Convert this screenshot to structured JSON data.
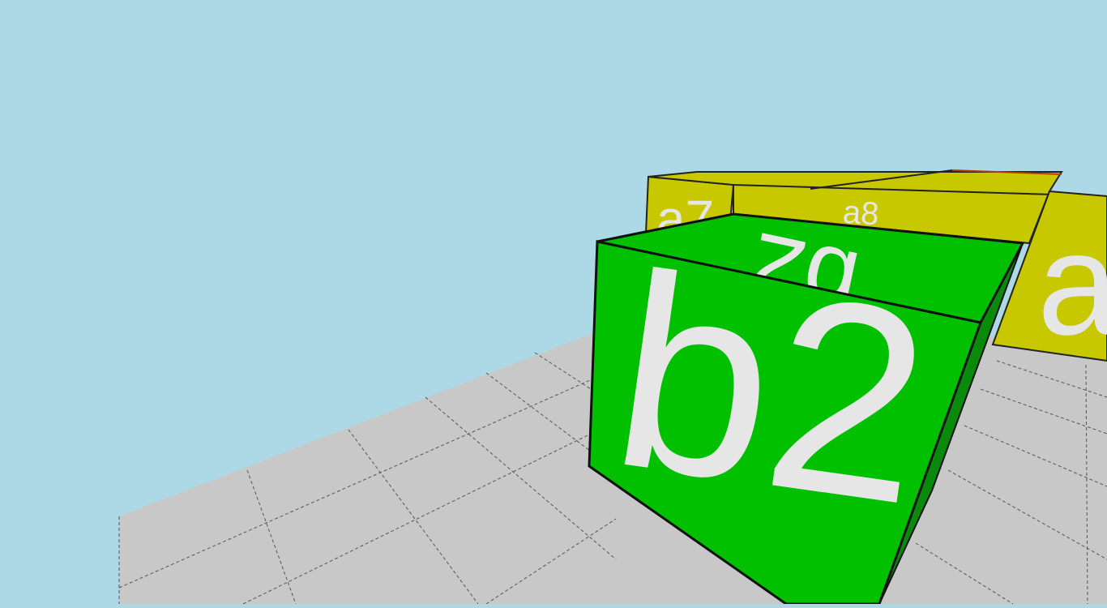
{
  "scene": {
    "sky_color": "#add8e6",
    "floor_color": "#c8c8c8",
    "floor_grid_color": "#555555"
  },
  "cubes": {
    "selected": {
      "label": "b2",
      "top_label": "b2",
      "color": "#00c000",
      "text_color": "#e6e6e6"
    },
    "back_left": {
      "label": "a7",
      "color": "#c8c800"
    },
    "back_right": {
      "label": "a",
      "color": "#c8c800"
    },
    "back_row_top": {
      "label": "a8",
      "color": "#c8c800"
    }
  }
}
